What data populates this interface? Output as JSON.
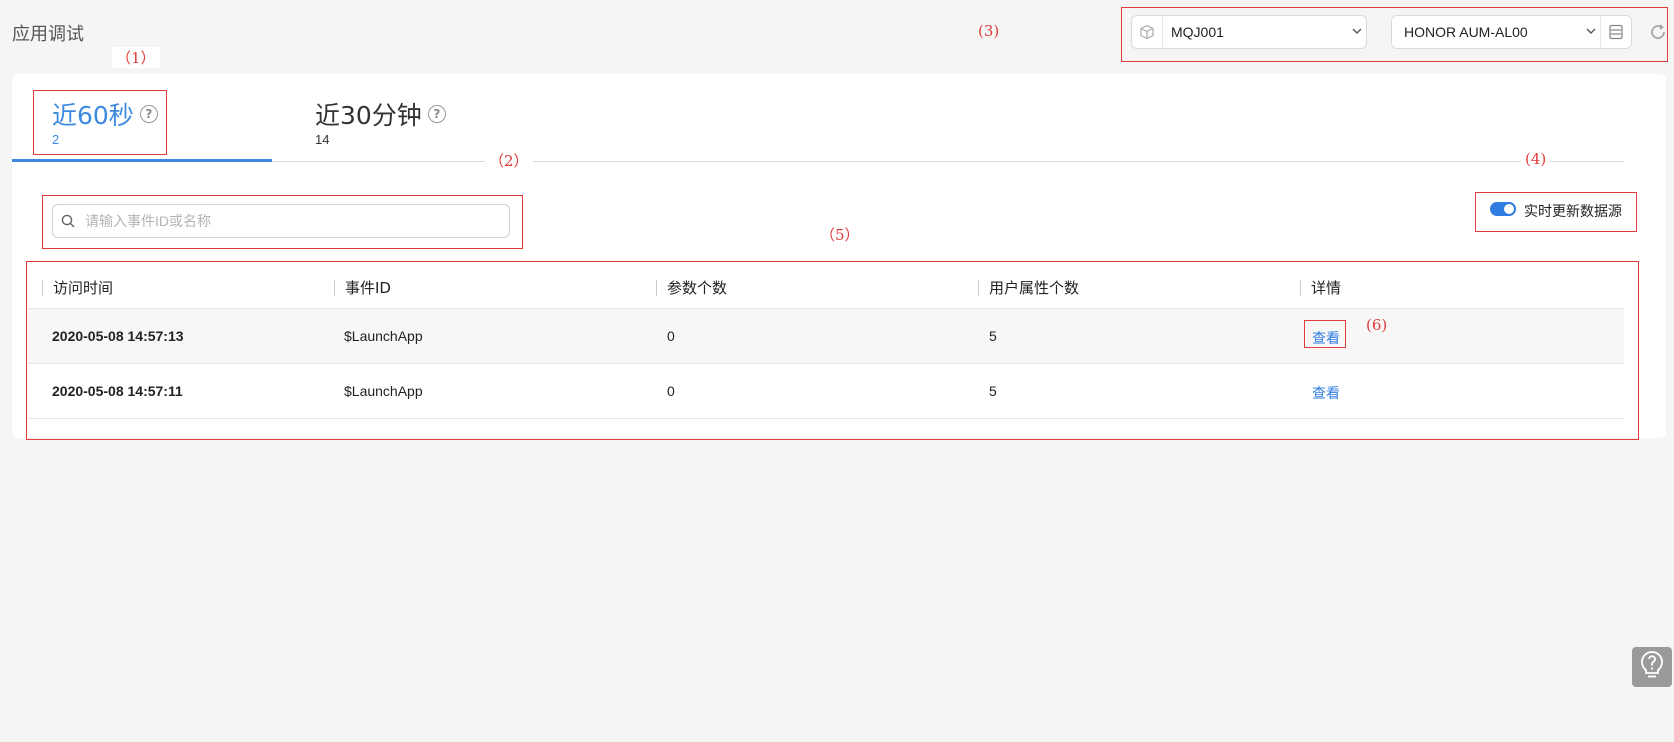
{
  "page": {
    "title": "应用调试"
  },
  "annotations": {
    "m1": "（1）",
    "m2": "（2）",
    "m3": "(3)",
    "m4": "(4)",
    "m5": "（5）",
    "m6": "(6)"
  },
  "selectors": {
    "app": {
      "value": "MQJ001",
      "icon": "cube-icon"
    },
    "device": {
      "value": "HONOR AUM-AL00",
      "icon": "device-list-icon"
    },
    "refresh_icon": "refresh-icon"
  },
  "tabs": [
    {
      "label": "近60秒",
      "count": "2",
      "active": true
    },
    {
      "label": "近30分钟",
      "count": "14",
      "active": false
    }
  ],
  "search": {
    "placeholder": "请输入事件ID或名称",
    "value": ""
  },
  "realtime_toggle": {
    "label": "实时更新数据源",
    "on": true
  },
  "table": {
    "columns": [
      "访问时间",
      "事件ID",
      "参数个数",
      "用户属性个数",
      "详情"
    ],
    "rows": [
      {
        "time": "2020-05-08 14:57:13",
        "event_id": "$LaunchApp",
        "params": "0",
        "user_props": "5",
        "detail": "查看"
      },
      {
        "time": "2020-05-08 14:57:11",
        "event_id": "$LaunchApp",
        "params": "0",
        "user_props": "5",
        "detail": "查看"
      }
    ]
  },
  "colors": {
    "accent": "#3d8ae0",
    "annotation": "#e23b3b"
  }
}
